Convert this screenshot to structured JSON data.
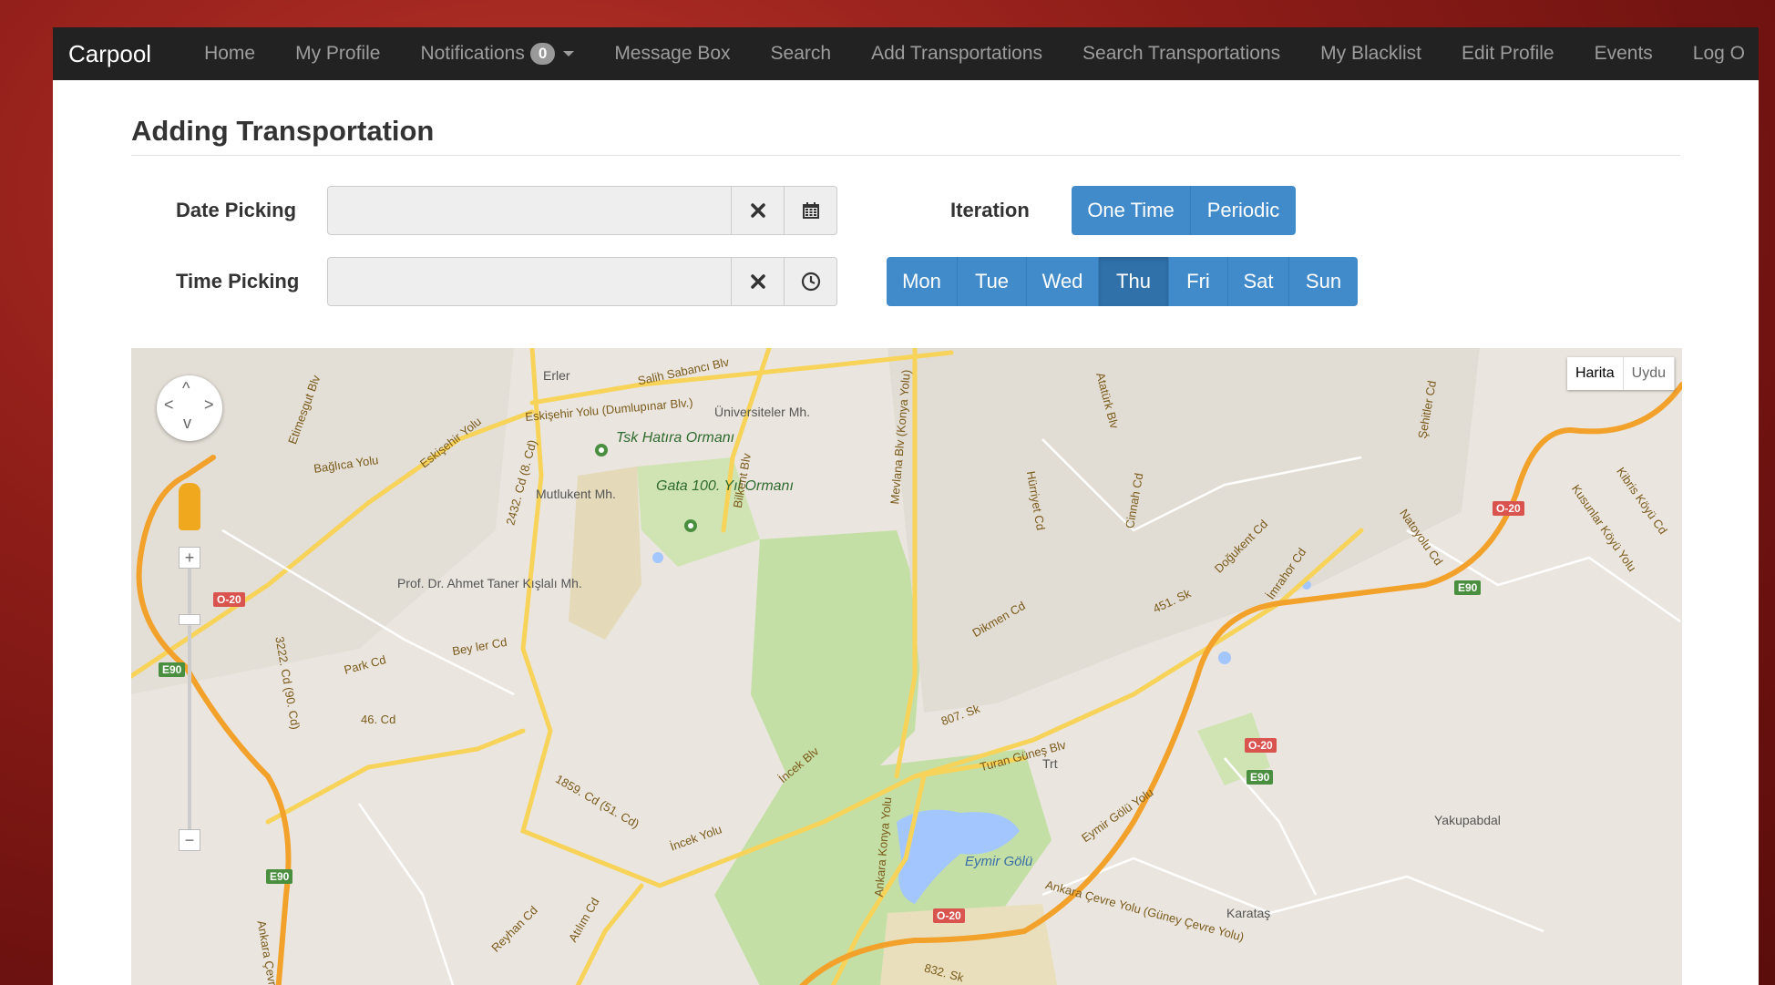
{
  "navbar": {
    "brand": "Carpool",
    "items": [
      "Home",
      "My Profile",
      "Notifications",
      "Message Box",
      "Search",
      "Add Transportations",
      "Search Transportations",
      "My Blacklist",
      "Edit Profile",
      "Events",
      "Log O"
    ],
    "notifications_count": "0"
  },
  "page": {
    "title": "Adding Transportation",
    "date_label": "Date Picking",
    "time_label": "Time Picking",
    "date_value": "",
    "time_value": "",
    "iteration_label": "Iteration",
    "iteration_options": [
      "One Time",
      "Periodic"
    ],
    "days": [
      "Mon",
      "Tue",
      "Wed",
      "Thu",
      "Fri",
      "Sat",
      "Sun"
    ],
    "active_day": "Thu"
  },
  "map": {
    "type_buttons": [
      "Harita",
      "Uydu"
    ],
    "labels": [
      "Erler",
      "Salih Sabancı Blv",
      "Eskişehir Yolu (Dumlupınar Blv.)",
      "Üniversiteler Mh.",
      "Tsk Hatıra Ormanı",
      "Gata 100. Yıl Ormanı",
      "Mutlukent Mh.",
      "Bağlıca Yolu",
      "Eskişehir Yolu",
      "Etimesgut Blv",
      "2432. Cd (8. Cd)",
      "Bilkent Blv",
      "Prof. Dr. Ahmet Taner Kışlalı Mh.",
      "Bey ler Cd",
      "Park Cd",
      "3222. Cd (90. Cd)",
      "46. Cd",
      "Mevlana Blv (Konya Yolu)",
      "Hürriyet Cd",
      "Dikmen Cd",
      "807. Sk",
      "Turan Güneş Blv",
      "451. Sk",
      "Doğukent Cd",
      "İmrahor Cd",
      "Natoyolu Cd",
      "Kusunlar Köyü Yolu",
      "Kibris Köyü Cd",
      "Şehitler Cd",
      "Atatürk Blv",
      "Cinnah Cd",
      "Yakupabdal",
      "Karataş",
      "Eymir Gölü",
      "Eymir Gölü Yolu",
      "Ankara Çevre Yolu (Güney Çevre Yolu)",
      "Ankara Konya Yolu",
      "İncek Blv",
      "1859. Cd (51. Cd)",
      "İncek Yolu",
      "Reyhan Cd",
      "Atılım Cd",
      "832. Sk",
      "Trt",
      "Ankara Çevre"
    ],
    "shields": [
      "O-20",
      "E90"
    ],
    "pan_arrows": [
      "^",
      "<",
      ">",
      "v"
    ],
    "zoom_in": "+",
    "zoom_out": "−"
  },
  "colors": {
    "navbar_bg": "#222222",
    "primary": "#428bca",
    "primary_active": "#3071a9",
    "map_bg": "#eae6df",
    "road_major": "#f2a12b",
    "road_minor": "#f7d35a",
    "park": "#c4dfa5",
    "water": "#a3c6ff"
  },
  "icons": {
    "clear": "close-icon",
    "calendar": "calendar-icon",
    "clock": "clock-icon",
    "pegman": "pegman-icon"
  }
}
